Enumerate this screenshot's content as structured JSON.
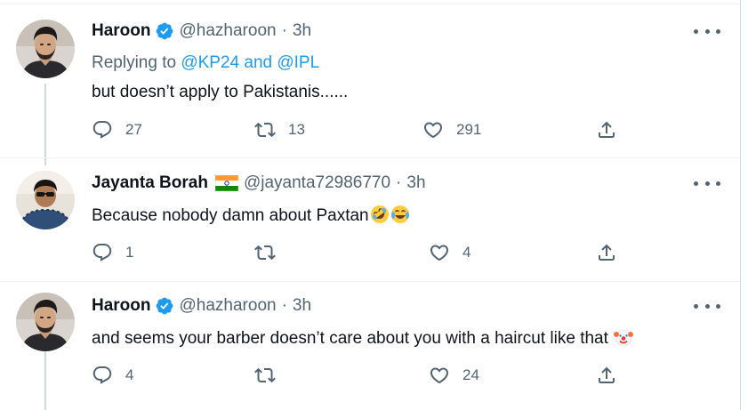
{
  "colors": {
    "accent": "#1d9bf0",
    "secondary_text": "#536471",
    "primary_text": "#0f1419",
    "divider": "#eff3f4",
    "thread_line": "#cfd9de"
  },
  "tweets": [
    {
      "name": "Haroon",
      "verified": true,
      "handle": "@hazharoon",
      "separator": "·",
      "time": "3h",
      "reply_prefix": "Replying to ",
      "reply_mentions": "@KP24 and @IPL",
      "text": "but doesn’t apply to Pakistanis......",
      "stats": {
        "replies": "27",
        "retweets": "13",
        "likes": "291"
      },
      "avatar_icon": "profile-photo-haroon"
    },
    {
      "name": "Jayanta Borah",
      "flag_icon": "india-flag-emoji",
      "handle": "@jayanta72986770",
      "separator": "·",
      "time": "3h",
      "text": "Because nobody damn about Paxtan",
      "text_emojis": [
        "rolling-on-floor-laughing-emoji",
        "tears-of-joy-emoji"
      ],
      "stats": {
        "replies": "1",
        "retweets": "",
        "likes": "4"
      },
      "avatar_icon": "profile-photo-jayanta"
    },
    {
      "name": "Haroon",
      "verified": true,
      "handle": "@hazharoon",
      "separator": "·",
      "time": "3h",
      "text": "and seems your barber doesn’t care about you with a haircut like that",
      "text_emojis": [
        "clown-face-emoji"
      ],
      "stats": {
        "replies": "4",
        "retweets": "",
        "likes": "24"
      },
      "avatar_icon": "profile-photo-haroon"
    }
  ],
  "icons": {
    "reply": "reply-icon",
    "retweet": "retweet-icon",
    "like": "heart-icon",
    "share": "share-icon",
    "more": "more-options-icon",
    "verified": "verified-badge-icon"
  }
}
